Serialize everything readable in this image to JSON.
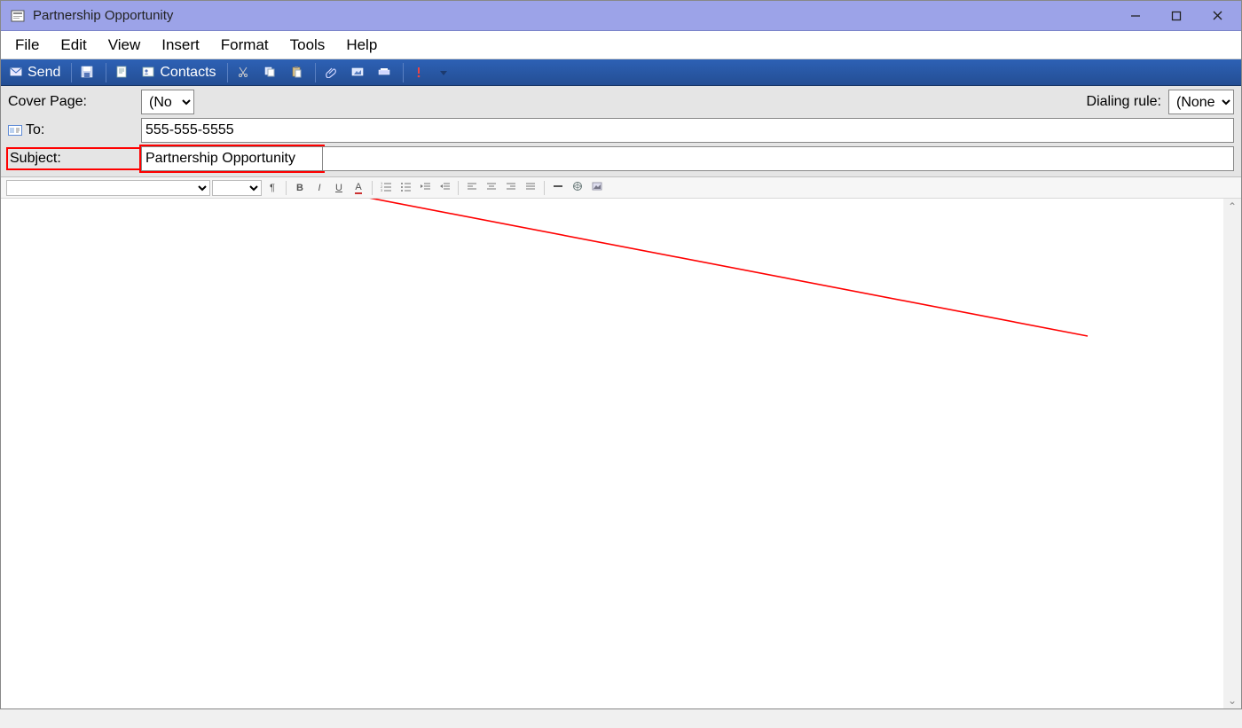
{
  "window": {
    "title": "Partnership Opportunity"
  },
  "menu": {
    "items": [
      "File",
      "Edit",
      "View",
      "Insert",
      "Format",
      "Tools",
      "Help"
    ]
  },
  "toolbar": {
    "send_label": "Send",
    "contacts_label": "Contacts"
  },
  "fields": {
    "cover_page_label": "Cover Page:",
    "cover_page_value": "(No",
    "dialing_rule_label": "Dialing rule:",
    "dialing_rule_value": "(None",
    "to_label": "To:",
    "to_value": "555-555-5555",
    "subject_label": "Subject:",
    "subject_value": "Partnership Opportunity"
  },
  "body": {
    "content": ""
  }
}
